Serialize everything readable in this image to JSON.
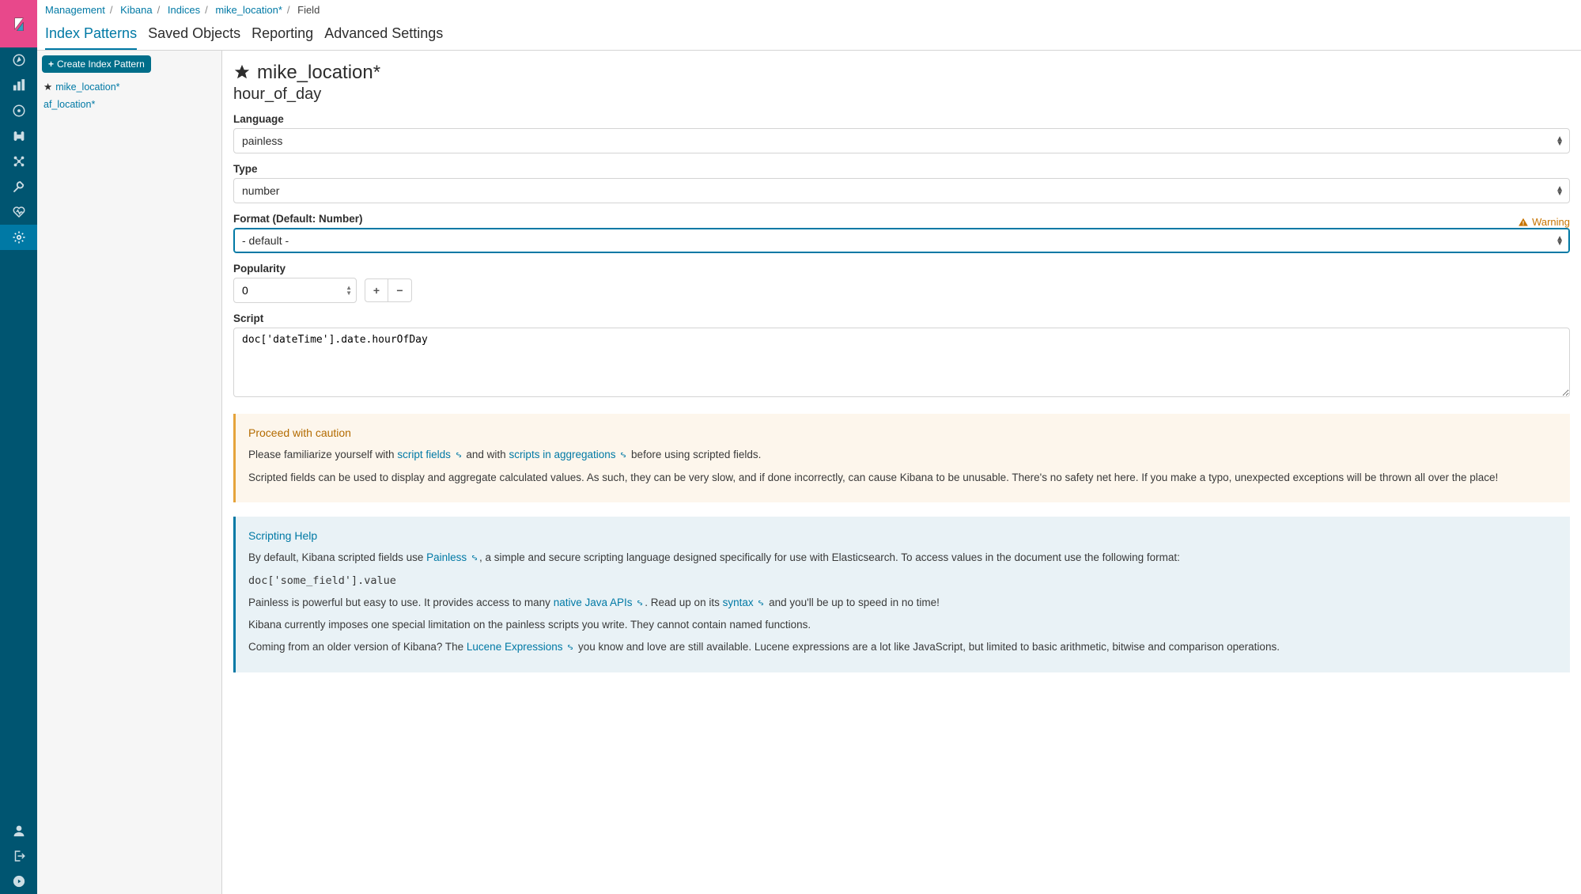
{
  "breadcrumbs": [
    "Management",
    "Kibana",
    "Indices",
    "mike_location*",
    "Field"
  ],
  "tabs": [
    "Index Patterns",
    "Saved Objects",
    "Reporting",
    "Advanced Settings"
  ],
  "active_tab": 0,
  "sidebar": {
    "create_label": "Create Index Pattern",
    "items": [
      {
        "label": "mike_location*",
        "default": true
      },
      {
        "label": "af_location*",
        "default": false
      }
    ]
  },
  "page": {
    "pattern_title": "mike_location*",
    "field_name": "hour_of_day",
    "labels": {
      "language": "Language",
      "type": "Type",
      "format": "Format (Default: Number)",
      "popularity": "Popularity",
      "script": "Script",
      "warning": "Warning"
    },
    "values": {
      "language": "painless",
      "type": "number",
      "format": "- default -",
      "popularity": "0",
      "script": "doc['dateTime'].date.hourOfDay"
    }
  },
  "caution": {
    "title": "Proceed with caution",
    "p1_a": "Please familiarize yourself with ",
    "link1": "script fields",
    "p1_b": " and with ",
    "link2": "scripts in aggregations",
    "p1_c": " before using scripted fields.",
    "p2": "Scripted fields can be used to display and aggregate calculated values. As such, they can be very slow, and if done incorrectly, can cause Kibana to be unusable. There's no safety net here. If you make a typo, unexpected exceptions will be thrown all over the place!"
  },
  "help": {
    "title": "Scripting Help",
    "p1_a": "By default, Kibana scripted fields use ",
    "link_painless": "Painless",
    "p1_b": ", a simple and secure scripting language designed specifically for use with Elasticsearch. To access values in the document use the following format:",
    "code": "doc['some_field'].value",
    "p2_a": "Painless is powerful but easy to use. It provides access to many ",
    "link_java": "native Java APIs",
    "p2_b": ". Read up on its ",
    "link_syntax": "syntax",
    "p2_c": " and you'll be up to speed in no time!",
    "p3": "Kibana currently imposes one special limitation on the painless scripts you write. They cannot contain named functions.",
    "p4_a": "Coming from an older version of Kibana? The ",
    "link_lucene": "Lucene Expressions",
    "p4_b": " you know and love are still available. Lucene expressions are a lot like JavaScript, but limited to basic arithmetic, bitwise and comparison operations."
  }
}
